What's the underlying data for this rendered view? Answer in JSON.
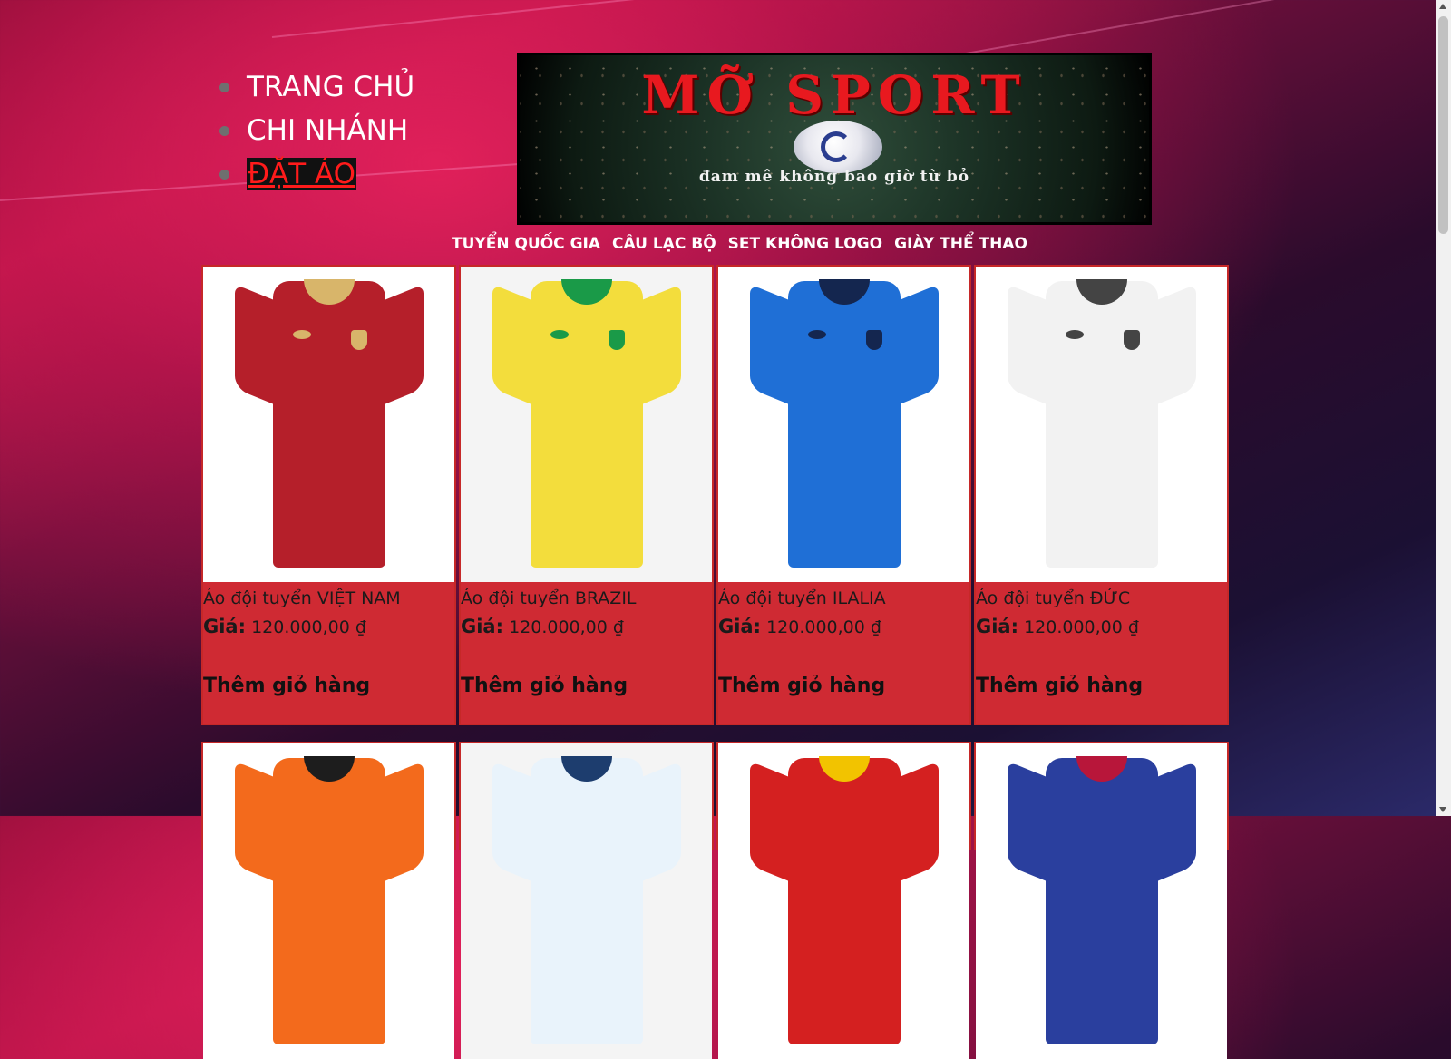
{
  "side_nav": {
    "items": [
      {
        "label": "TRANG CHỦ"
      },
      {
        "label": "CHI NHÁNH"
      },
      {
        "label": "ĐẶT ÁO"
      }
    ]
  },
  "banner": {
    "title": "MỠ SPORT",
    "tagline": "đam mê không bao giờ từ bỏ"
  },
  "category_menu": {
    "items": [
      "TUYỂN QUỐC GIA",
      "CÂU LẠC BỘ",
      "SET KHÔNG LOGO",
      "GIÀY THỂ THAO"
    ]
  },
  "products": {
    "price_label": "Giá:",
    "cart_label": "Thêm giỏ hàng",
    "items": [
      {
        "name": "Áo đội tuyển VIỆT NAM",
        "price": "120.000,00 ₫",
        "body_color": "#b51f2a",
        "accent_color": "#d8b56a",
        "icon": "vietnam-jersey-image"
      },
      {
        "name": "Áo đội tuyển BRAZIL",
        "price": "120.000,00 ₫",
        "body_color": "#f3dd3c",
        "accent_color": "#1a9a48",
        "icon": "brazil-jersey-image"
      },
      {
        "name": "Áo đội tuyển ILALIA",
        "price": "120.000,00 ₫",
        "body_color": "#1f6fd6",
        "accent_color": "#14264f",
        "icon": "italy-jersey-image"
      },
      {
        "name": "Áo đội tuyển ĐỨC",
        "price": "120.000,00 ₫",
        "body_color": "#f2f2f2",
        "accent_color": "#444444",
        "icon": "germany-jersey-image"
      }
    ],
    "row2": [
      {
        "body_color": "#f36a1c",
        "accent_color": "#1d1d1d",
        "icon": "netherlands-jersey-image"
      },
      {
        "body_color": "#e9f3fb",
        "accent_color": "#1d3d6e",
        "icon": "argentina-jersey-image"
      },
      {
        "body_color": "#d42020",
        "accent_color": "#f2c300",
        "icon": "spain-jersey-image"
      },
      {
        "body_color": "#2a3f9e",
        "accent_color": "#b8163a",
        "icon": "barcelona-jersey-image"
      }
    ]
  }
}
